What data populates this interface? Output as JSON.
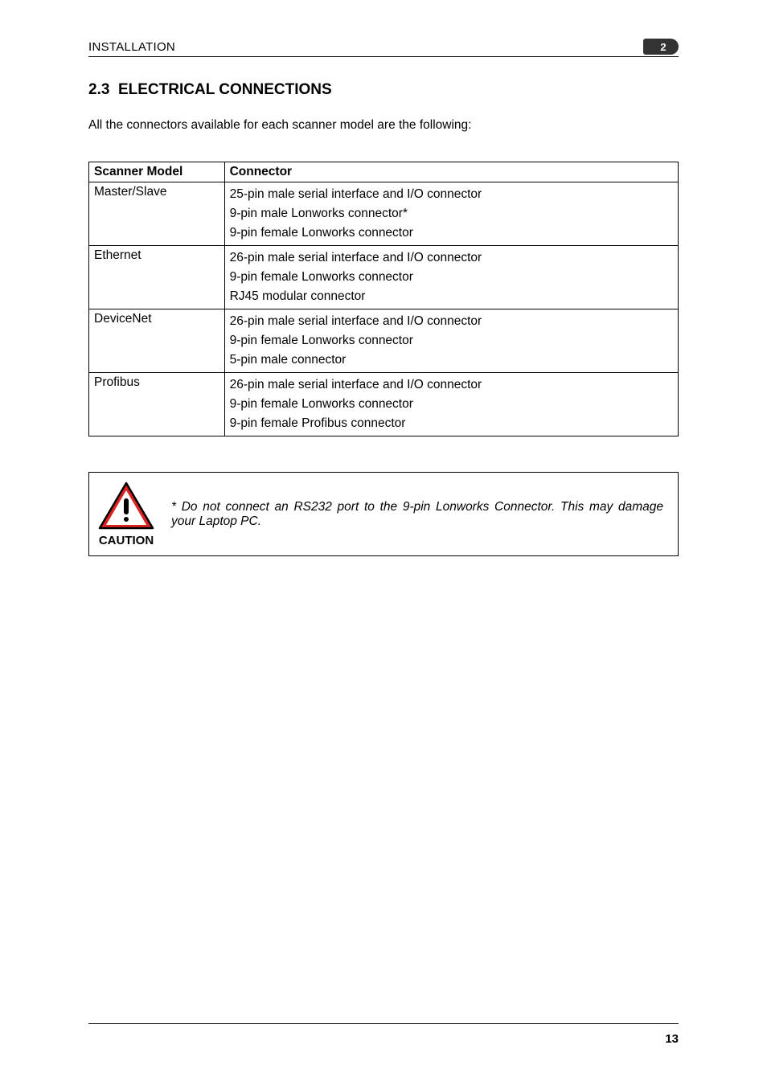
{
  "header": {
    "title": "INSTALLATION",
    "chapter_number": "2"
  },
  "section": {
    "number": "2.3",
    "title": "ELECTRICAL CONNECTIONS"
  },
  "intro": "All the connectors available for each scanner model are the following:",
  "table": {
    "headers": {
      "model": "Scanner Model",
      "connector": "Connector"
    },
    "rows": [
      {
        "model": "Master/Slave",
        "connectors": [
          "25-pin male serial interface and I/O connector",
          "9-pin male Lonworks connector*",
          "9-pin female Lonworks connector"
        ]
      },
      {
        "model": "Ethernet",
        "connectors": [
          "26-pin male serial interface and I/O connector",
          "9-pin female Lonworks connector",
          "RJ45 modular connector"
        ]
      },
      {
        "model": "DeviceNet",
        "connectors": [
          "26-pin male serial interface and I/O connector",
          "9-pin female Lonworks connector",
          "5-pin male connector"
        ]
      },
      {
        "model": "Profibus",
        "connectors": [
          "26-pin male serial interface and I/O connector",
          "9-pin female Lonworks connector",
          "9-pin female Profibus connector"
        ]
      }
    ]
  },
  "caution": {
    "label": "CAUTION",
    "text": "* Do not connect an RS232 port to the 9-pin Lonworks Connector. This may damage your Laptop PC."
  },
  "footer": {
    "page": "13"
  }
}
